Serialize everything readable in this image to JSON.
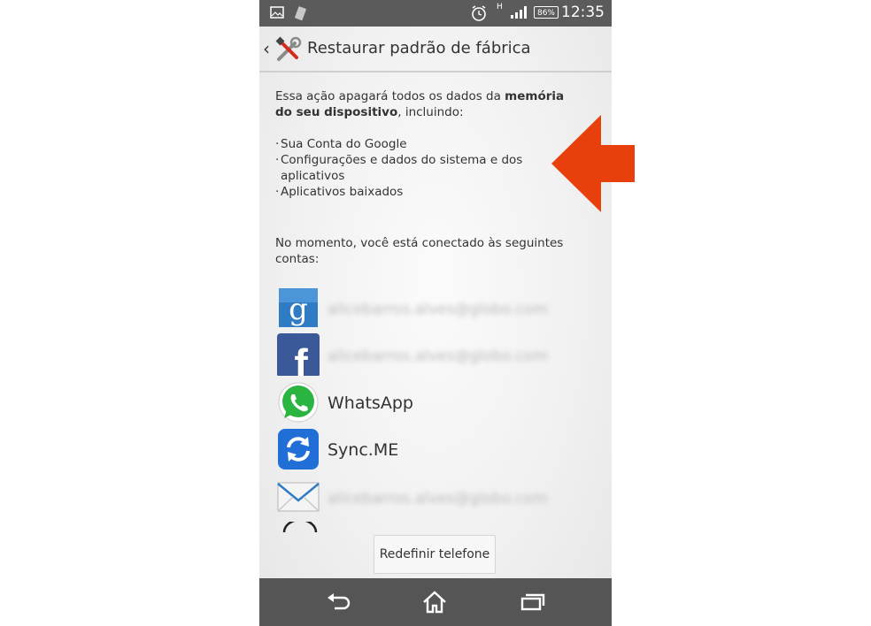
{
  "status_bar": {
    "battery": "86%",
    "time": "12:35",
    "network": "H"
  },
  "header": {
    "title": "Restaurar padrão de fábrica"
  },
  "content": {
    "warning_prefix": "Essa ação apagará todos os dados da ",
    "warning_bold": "memória do seu dispositivo",
    "warning_suffix": ", incluindo:",
    "bullets": [
      "Sua Conta do Google",
      "Configurações e dados do sistema e dos aplicativos",
      "Aplicativos baixados"
    ],
    "accounts_intro": "No momento, você está conectado às seguintes contas:",
    "accounts": [
      {
        "icon": "google-icon",
        "name": "alicebarros.alves@globo.com"
      },
      {
        "icon": "facebook-icon",
        "name": "alicebarros.alves@globo.com"
      },
      {
        "icon": "whatsapp-icon",
        "name": "WhatsApp"
      },
      {
        "icon": "sync-me-icon",
        "name": "Sync.ME"
      },
      {
        "icon": "email-icon",
        "name": "alicebarros.alves@globo.com"
      }
    ]
  },
  "reset_button": {
    "label": "Redefinir telefone"
  },
  "colors": {
    "status_bar": "#5b5b5b",
    "nav_bar": "#555555",
    "annotation_arrow": "#e8400c",
    "google_blue": "#2f7cc4",
    "facebook_blue": "#3b5998",
    "whatsapp_green": "#2ab540",
    "sync_blue": "#1f6fd6"
  }
}
